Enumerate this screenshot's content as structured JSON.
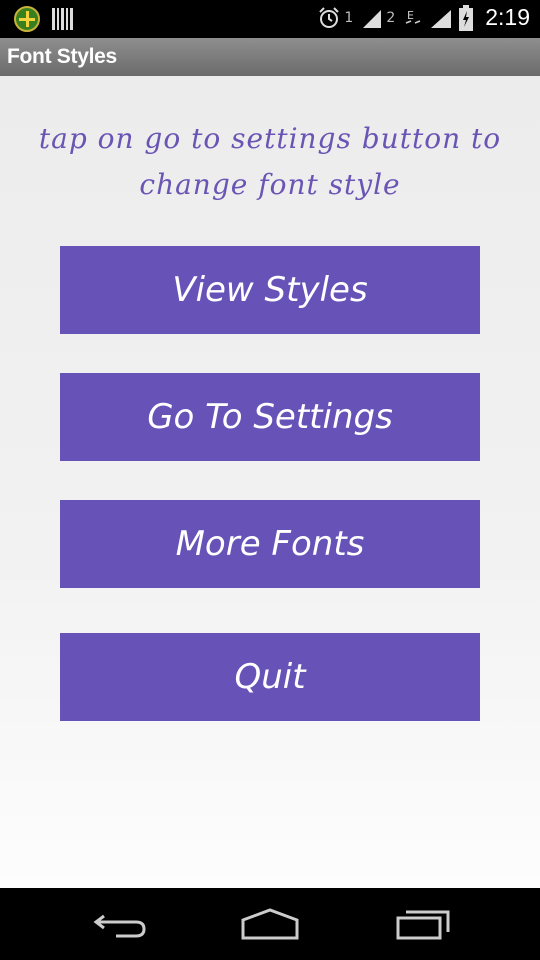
{
  "status_bar": {
    "sim1": "1",
    "sim2": "2",
    "clock": "2:19",
    "icons": [
      "app-notification-icon",
      "barcode-icon",
      "alarm-icon",
      "signal-icon",
      "signal-icon",
      "data-e-icon",
      "signal-icon",
      "battery-charging-icon"
    ]
  },
  "action_bar": {
    "title": "Font Styles"
  },
  "main": {
    "hint_line1": "tap on go to settings button to",
    "hint_line2": "change font style",
    "buttons": {
      "view_styles": "View Styles",
      "go_to_settings": "Go To Settings",
      "more_fonts": "More Fonts",
      "quit": "Quit"
    }
  },
  "nav_bar": {
    "icons": [
      "back-icon",
      "home-icon",
      "recent-apps-icon"
    ]
  },
  "colors": {
    "accent": "#6752b7",
    "hint_text": "#6a55b4",
    "action_bar": "#7a7a7a"
  }
}
